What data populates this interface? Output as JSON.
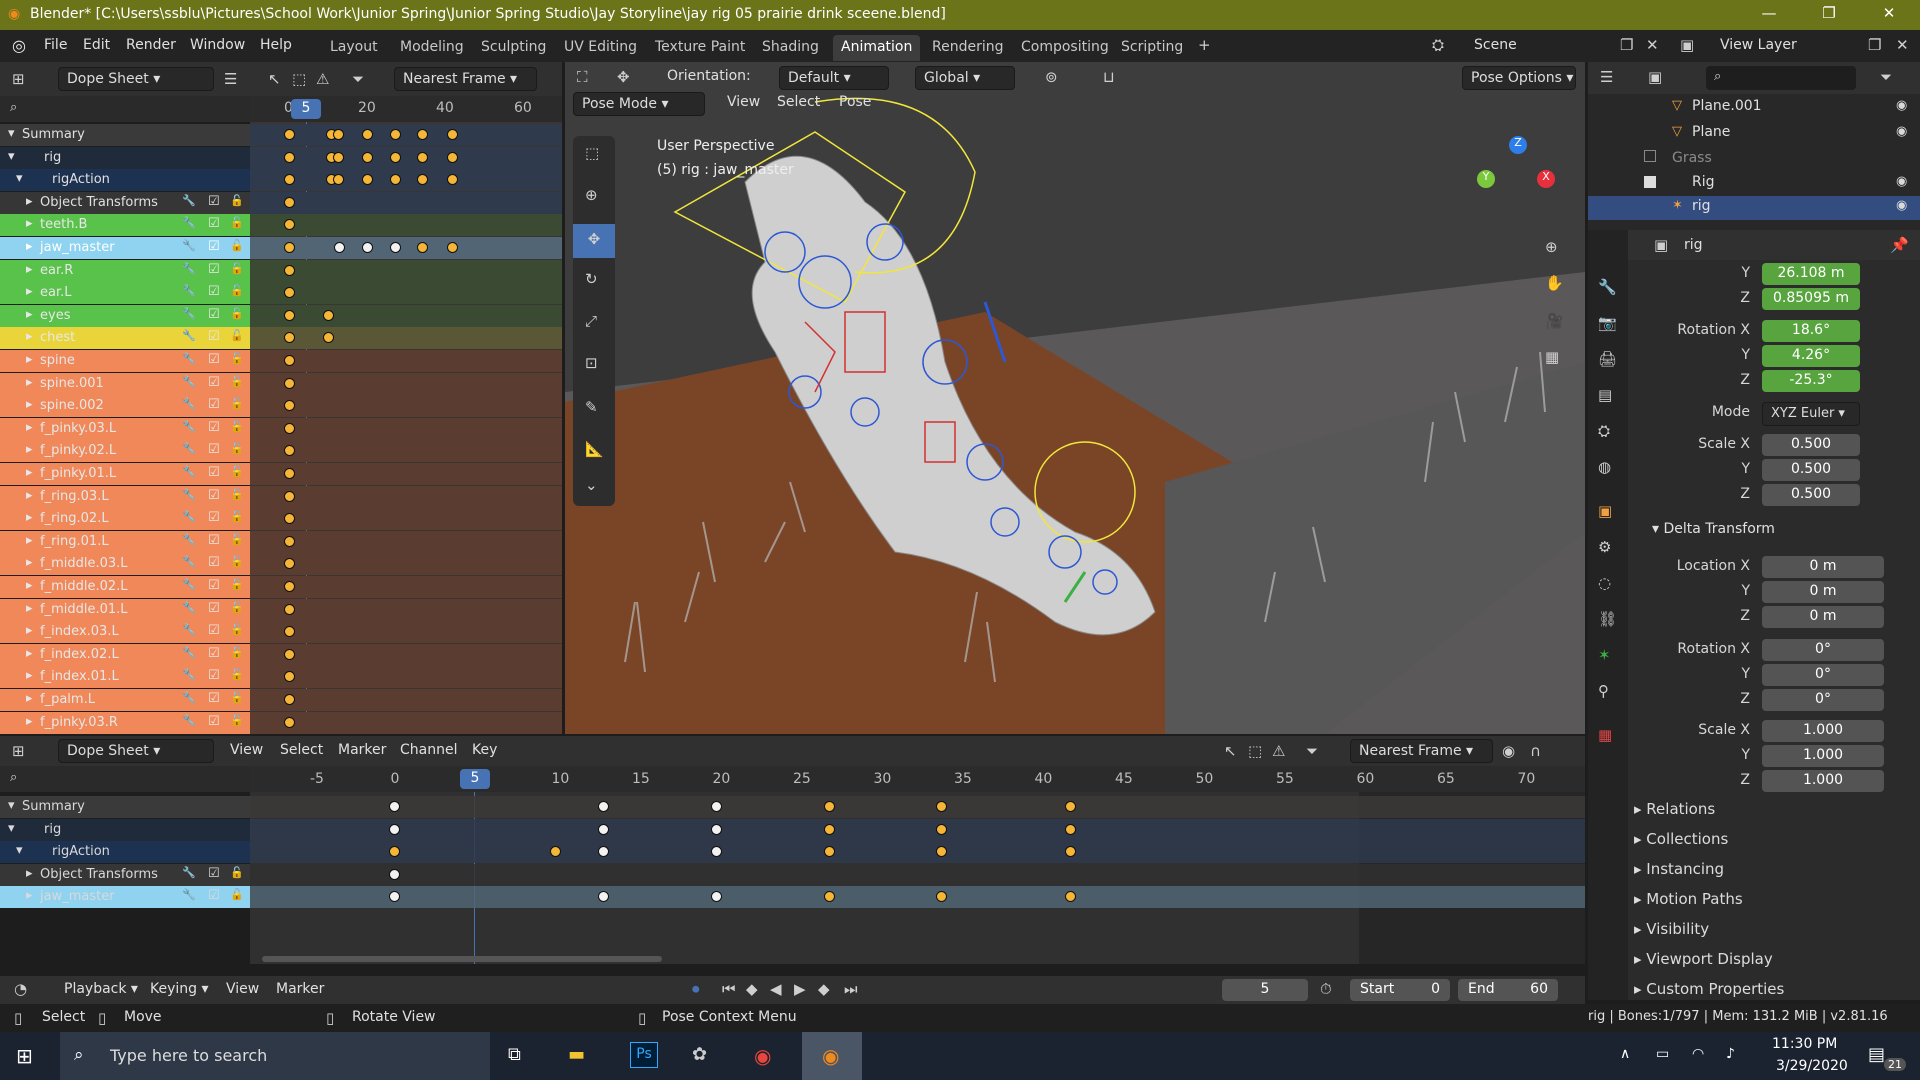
{
  "window": {
    "title": "Blender* [C:\\Users\\ssblu\\Pictures\\School Work\\Junior Spring\\Junior Spring Studio\\Jay Storyline\\jay rig 05 prairie drink sceene.blend]"
  },
  "menus": [
    "File",
    "Edit",
    "Render",
    "Window",
    "Help"
  ],
  "workspaces": [
    "Layout",
    "Modeling",
    "Sculpting",
    "UV Editing",
    "Texture Paint",
    "Shading",
    "Animation",
    "Rendering",
    "Compositing",
    "Scripting"
  ],
  "active_workspace": "Animation",
  "scene": "Scene",
  "view_layer": "View Layer",
  "dopesheet_top": {
    "editor": "Dope Sheet",
    "snap": "Nearest Frame",
    "ticks": [
      "0",
      "20",
      "40",
      "60"
    ],
    "current_frame": "5",
    "channels": [
      {
        "label": "Summary"
      },
      {
        "label": "rig"
      },
      {
        "label": "rigAction"
      },
      {
        "label": "Object Transforms"
      },
      {
        "label": "teeth.B"
      },
      {
        "label": "jaw_master"
      },
      {
        "label": "ear.R"
      },
      {
        "label": "ear.L"
      },
      {
        "label": "eyes"
      },
      {
        "label": "chest"
      },
      {
        "label": "spine"
      },
      {
        "label": "spine.001"
      },
      {
        "label": "spine.002"
      },
      {
        "label": "f_pinky.03.L"
      },
      {
        "label": "f_pinky.02.L"
      },
      {
        "label": "f_pinky.01.L"
      },
      {
        "label": "f_ring.03.L"
      },
      {
        "label": "f_ring.02.L"
      },
      {
        "label": "f_ring.01.L"
      },
      {
        "label": "f_middle.03.L"
      },
      {
        "label": "f_middle.02.L"
      },
      {
        "label": "f_middle.01.L"
      },
      {
        "label": "f_index.03.L"
      },
      {
        "label": "f_index.02.L"
      },
      {
        "label": "f_index.01.L"
      },
      {
        "label": "f_palm.L"
      },
      {
        "label": "f_pinky.03.R"
      }
    ]
  },
  "viewport": {
    "orientation_label": "Orientation:",
    "orientation": "Default",
    "transform_space": "Global",
    "mode": "Pose Mode",
    "menus": [
      "View",
      "Select",
      "Pose"
    ],
    "pose_options": "Pose Options",
    "perspective": "User Perspective",
    "info": "(5) rig : jaw_master"
  },
  "outliner": {
    "items": [
      {
        "label": "Plane.001"
      },
      {
        "label": "Plane"
      },
      {
        "label": "Grass"
      },
      {
        "label": "Rig"
      },
      {
        "label": "rig"
      }
    ]
  },
  "properties": {
    "object_name": "rig",
    "location_y": "26.108 m",
    "location_z": "0.85095 m",
    "rotation_label": "Rotation X",
    "rotation_x": "18.6°",
    "rotation_y": "4.26°",
    "rotation_z": "-25.3°",
    "mode_label": "Mode",
    "mode": "XYZ Euler",
    "scale_label": "Scale X",
    "scale_x": "0.500",
    "scale_y": "0.500",
    "scale_z": "0.500",
    "delta_title": "Delta Transform",
    "delta_location_label": "Location X",
    "delta_loc_x": "0 m",
    "delta_loc_y": "0 m",
    "delta_loc_z": "0 m",
    "delta_rot_x": "0°",
    "delta_rot_y": "0°",
    "delta_rot_z": "0°",
    "delta_scale_x": "1.000",
    "delta_scale_y": "1.000",
    "delta_scale_z": "1.000",
    "y_label": "Y",
    "z_label": "Z",
    "panels": [
      "Relations",
      "Collections",
      "Instancing",
      "Motion Paths",
      "Visibility",
      "Viewport Display",
      "Custom Properties"
    ]
  },
  "dopesheet_bottom": {
    "editor": "Dope Sheet",
    "menus": [
      "View",
      "Select",
      "Marker",
      "Channel",
      "Key"
    ],
    "snap": "Nearest Frame",
    "ticks": [
      "-5",
      "0",
      "5",
      "10",
      "15",
      "20",
      "25",
      "30",
      "35",
      "40",
      "45",
      "50",
      "55",
      "60",
      "65",
      "70"
    ],
    "channels": [
      {
        "label": "Summary"
      },
      {
        "label": "rig"
      },
      {
        "label": "rigAction"
      },
      {
        "label": "Object Transforms"
      },
      {
        "label": "jaw_master"
      }
    ]
  },
  "timeline": {
    "playback": "Playback",
    "keying": "Keying",
    "view": "View",
    "marker": "Marker",
    "current_frame": "5",
    "start_label": "Start",
    "start": "0",
    "end_label": "End",
    "end": "60"
  },
  "statusbar": {
    "select": "Select",
    "move": "Move",
    "rotate": "Rotate View",
    "context": "Pose Context Menu",
    "info": "rig | Bones:1/797 | Mem: 131.2 MiB | v2.81.16"
  },
  "taskbar": {
    "search_placeholder": "Type here to search",
    "time": "11:30 PM",
    "date": "3/29/2020",
    "notifications": "21"
  },
  "colors": {
    "title_bar": "#6b7418",
    "keyframe_selected": "#f5b638",
    "keyframe_unselected": "#f2f2f2",
    "channel_green": "#59c24b",
    "channel_orange": "#f0885a",
    "channel_yellow": "#e9d53a",
    "channel_selected": "#8fd3f0",
    "value_field_green": "#58a43f"
  }
}
